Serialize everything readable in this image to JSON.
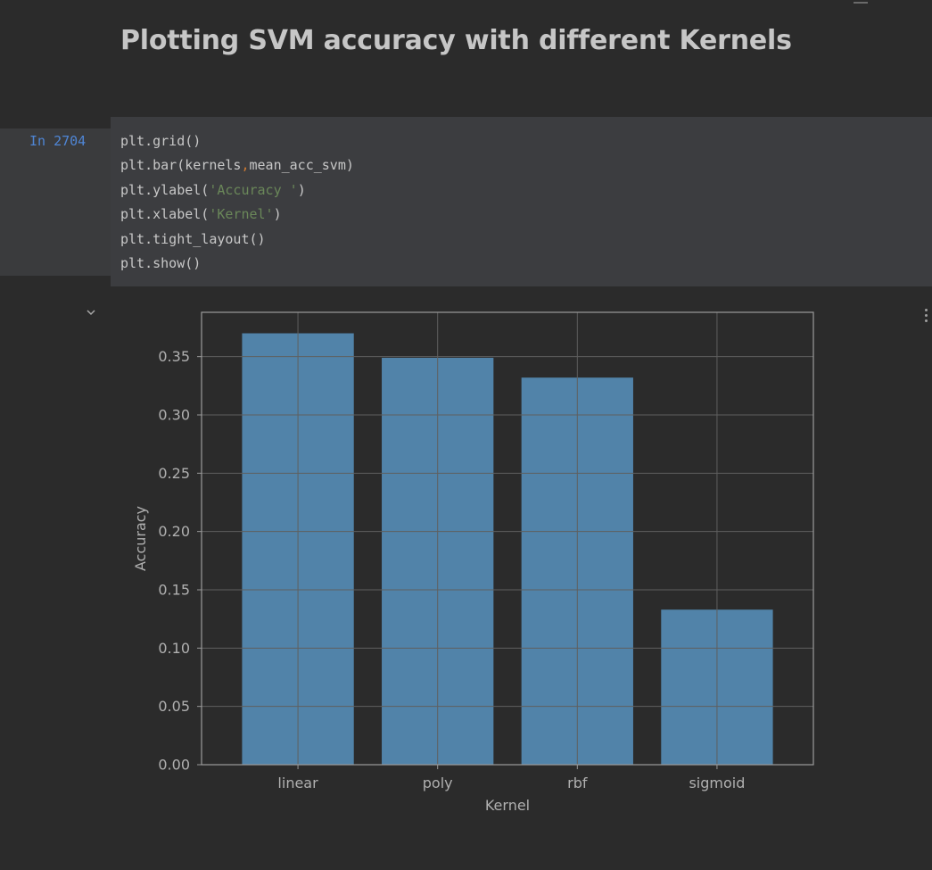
{
  "notebook": {
    "markdown_title": "Plotting SVM accuracy with different Kernels",
    "cell": {
      "prompt": "In 2704",
      "code_lines": [
        [
          {
            "text": "plt.grid()",
            "kind": "plain"
          }
        ],
        [
          {
            "text": "plt.bar(kernels",
            "kind": "plain"
          },
          {
            "text": ",",
            "kind": "comma"
          },
          {
            "text": "mean_acc_svm)",
            "kind": "plain"
          }
        ],
        [
          {
            "text": "plt.ylabel(",
            "kind": "plain"
          },
          {
            "text": "'Accuracy '",
            "kind": "str"
          },
          {
            "text": ")",
            "kind": "plain"
          }
        ],
        [
          {
            "text": "plt.xlabel(",
            "kind": "plain"
          },
          {
            "text": "'Kernel'",
            "kind": "str"
          },
          {
            "text": ")",
            "kind": "plain"
          }
        ],
        [
          {
            "text": "plt.tight_layout()",
            "kind": "plain"
          }
        ],
        [
          {
            "text": "plt.show()",
            "kind": "plain"
          }
        ]
      ]
    },
    "icons": {
      "collapse": "chevron-down-icon",
      "output_menu": "more-vertical-icon"
    }
  },
  "colors": {
    "background": "#2b2b2b",
    "code_background": "#3c3d40",
    "prompt": "#4f86d6",
    "string": "#6a8759",
    "bar": "#5183a9",
    "grid": "#5f5f5f",
    "axis": "#9a9a9a"
  },
  "chart_data": {
    "type": "bar",
    "categories": [
      "linear",
      "poly",
      "rbf",
      "sigmoid"
    ],
    "values": [
      0.37,
      0.349,
      0.332,
      0.133
    ],
    "xlabel": "Kernel",
    "ylabel": "Accuracy",
    "ylim": [
      0,
      0.388
    ],
    "yticks": [
      "0.00",
      "0.05",
      "0.10",
      "0.15",
      "0.20",
      "0.25",
      "0.30",
      "0.35"
    ],
    "ytick_values": [
      0,
      0.05,
      0.1,
      0.15,
      0.2,
      0.25,
      0.3,
      0.35
    ],
    "grid": true,
    "legend": "none"
  }
}
